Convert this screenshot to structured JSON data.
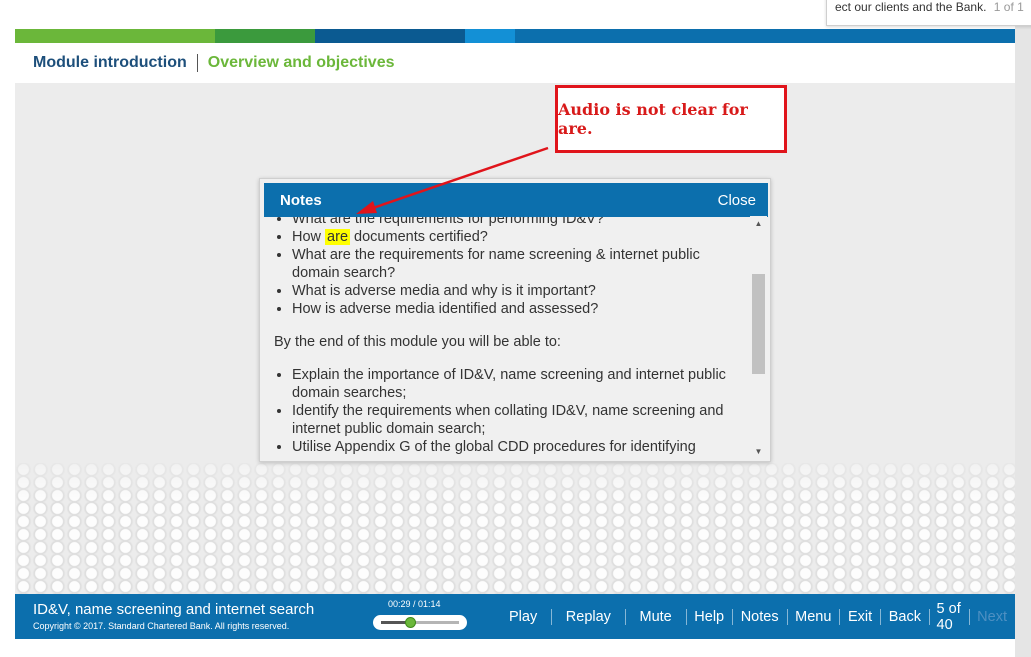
{
  "search_popup": {
    "text": "ect our clients and the Bank.",
    "count": "1 of 1"
  },
  "color_bar": [
    "#6bb73a",
    "#3b9a3d",
    "#0b5a91",
    "#1390d6",
    "#0c6fad"
  ],
  "header": {
    "module": "Module introduction",
    "section": "Overview and objectives"
  },
  "annotation": {
    "text": "Audio is not clear for are."
  },
  "notes": {
    "title": "Notes",
    "close_label": "Close",
    "list1": [
      "What are the requirements for performing ID&V?",
      "How are documents certified?",
      "What are the requirements for name screening & internet public domain search?",
      "What is adverse media and why is it important?",
      "How is adverse media identified and assessed?"
    ],
    "q2_prefix": "How ",
    "q2_highlight": "are",
    "q2_suffix": " documents certified?",
    "intro": "By the end of this module you will be able to:",
    "list2": [
      "Explain the importance of ID&V, name screening and internet public domain searches;",
      "Identify the requirements when collating ID&V, name screening and internet public domain search;",
      "Utilise Appendix G of the global CDD procedures for identifying"
    ]
  },
  "footer": {
    "course_title": "ID&V, name screening and internet search",
    "copyright": "Copyright © 2017. Standard Chartered Bank. All rights reserved.",
    "timer": "00:29 / 01:14",
    "progress": 0.39,
    "buttons": {
      "play": "Play",
      "replay": "Replay",
      "mute": "Mute",
      "help": "Help",
      "notes": "Notes",
      "menu": "Menu",
      "exit": "Exit",
      "back": "Back",
      "pager": "5 of 40",
      "next": "Next"
    }
  }
}
